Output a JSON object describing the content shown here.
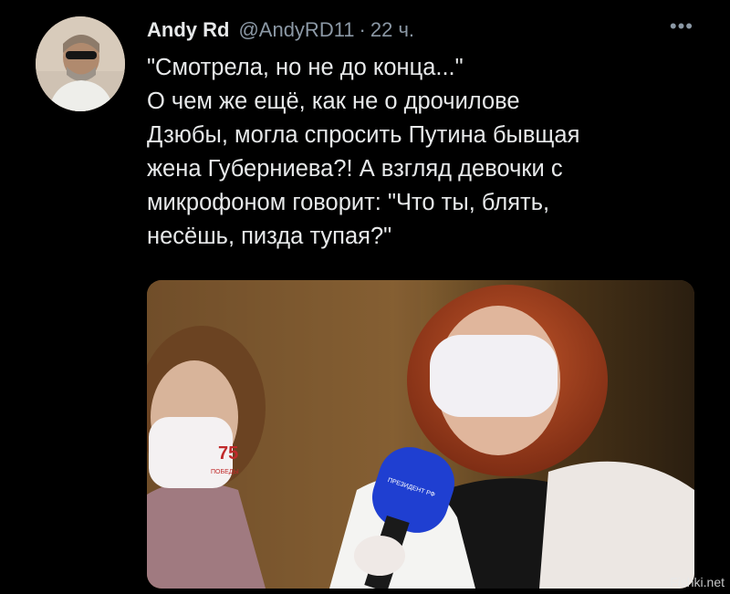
{
  "tweet": {
    "author_name": "Andy Rd",
    "author_handle": "@AndyRD11",
    "separator": "·",
    "time_ago": "22 ч.",
    "more_label": "•••",
    "text": "\"Смотрела, но не до конца...\"\nО чем же ещё, как не о дрочилове\nДзюбы, могла спросить Путина бывщая\nжена Губерниева?! А взгляд девочки с\nмикрофоном говорит: \"Что ты, блять,\nнесёшь, пизда тупая?\""
  },
  "media": {
    "microphone_label": "ПРЕЗИДЕНТ РФ",
    "mask_emblem_number": "75",
    "mask_emblem_text": "ПОБЕДЫ"
  },
  "watermark": "Fishki.net",
  "colors": {
    "background": "#000000",
    "text": "#e7e9ea",
    "secondary": "#8b98a5",
    "mic_blue": "#1f3fd1"
  }
}
